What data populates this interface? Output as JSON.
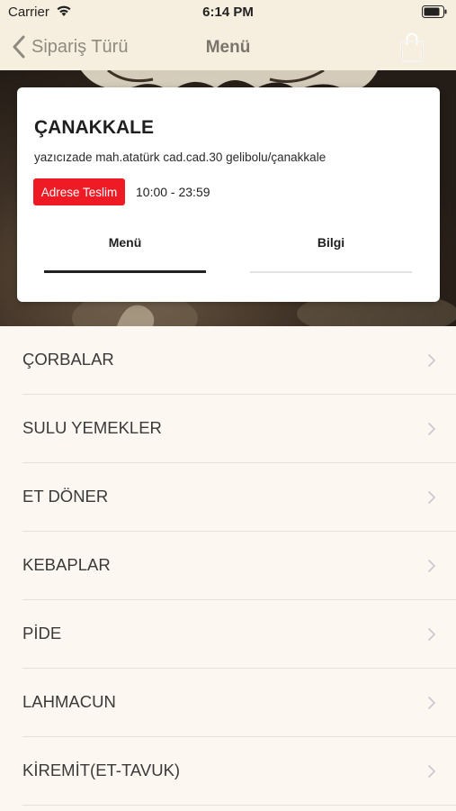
{
  "status_bar": {
    "carrier": "Carrier",
    "time": "6:14 PM"
  },
  "nav": {
    "back_label": "Sipariş Türü",
    "title": "Menü"
  },
  "store": {
    "name": "ÇANAKKALE",
    "address": "yazıcızade mah.atatürk cad.cad.30 gelibolu/çanakkale",
    "delivery_badge": "Adrese Teslim",
    "hours": "10:00 - 23:59"
  },
  "tabs": [
    {
      "label": "Menü",
      "active": true
    },
    {
      "label": "Bilgi",
      "active": false
    }
  ],
  "categories": [
    {
      "label": "ÇORBALAR"
    },
    {
      "label": "SULU YEMEKLER"
    },
    {
      "label": "ET DÖNER"
    },
    {
      "label": "KEBAPLAR"
    },
    {
      "label": "PİDE"
    },
    {
      "label": "LAHMACUN"
    },
    {
      "label": "KİREMİT(ET-TAVUK)"
    }
  ],
  "colors": {
    "badge": "#ee1a24",
    "header_bg": "#f6efdf",
    "page_bg": "#fcf8f1"
  }
}
